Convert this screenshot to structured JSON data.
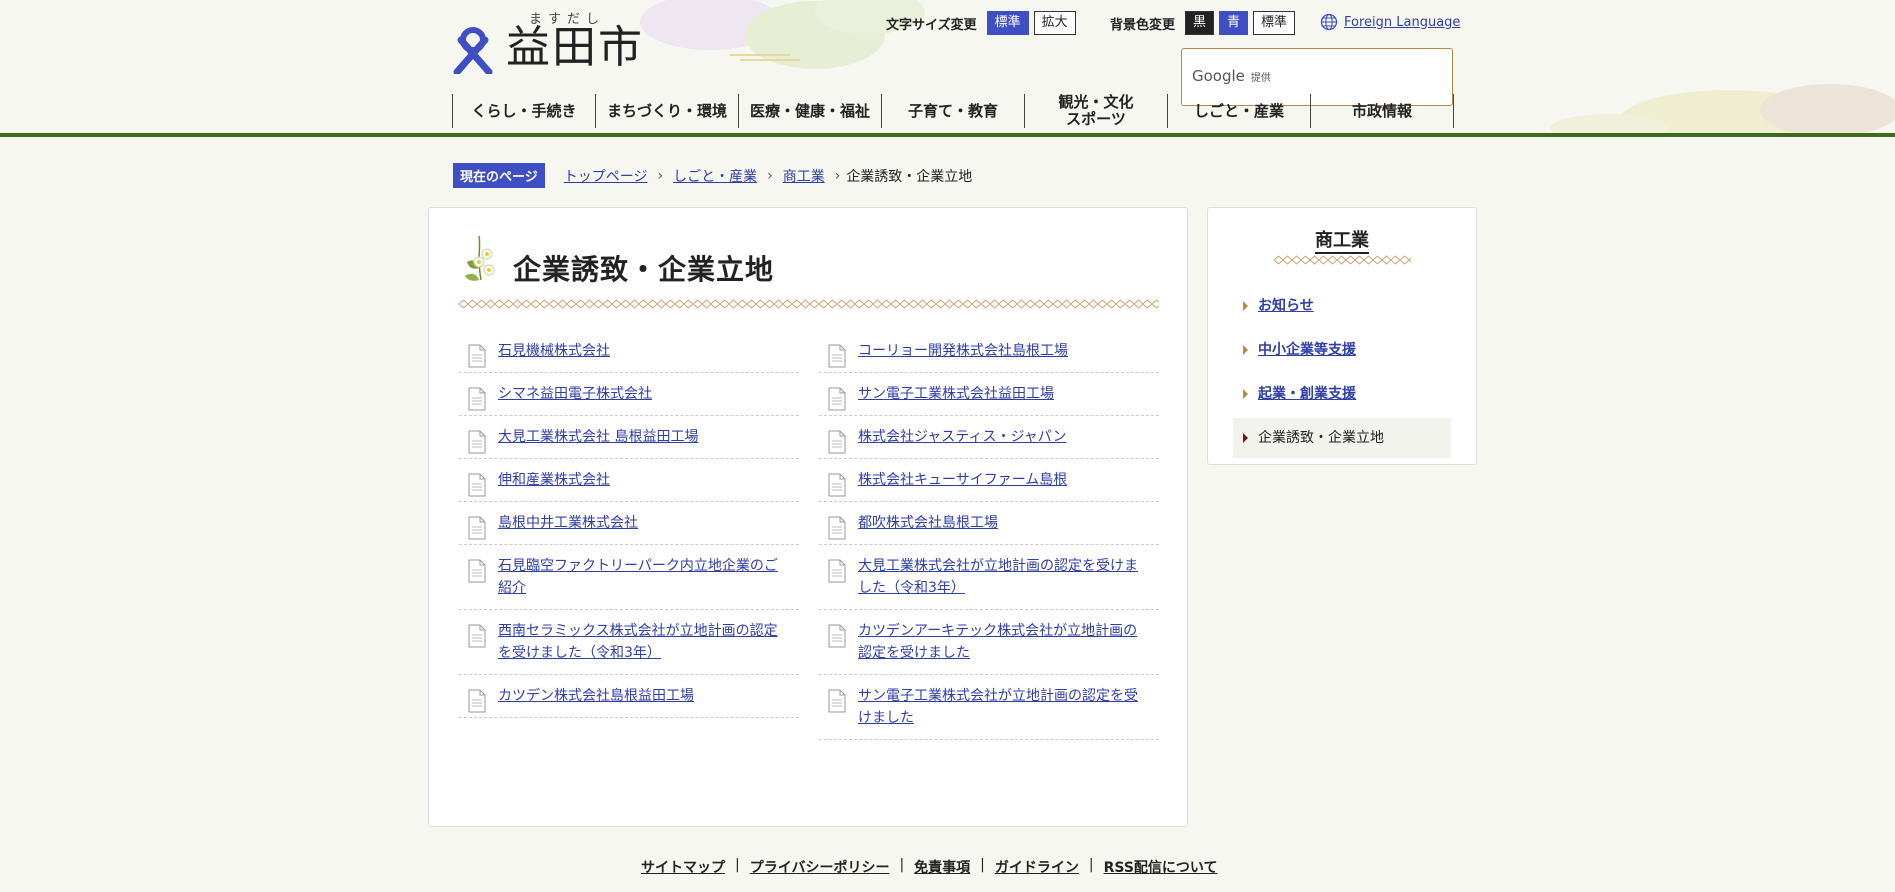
{
  "site": {
    "logo_text": "益田市",
    "logo_ruby": "ますだし"
  },
  "utility": {
    "font_size_label": "文字サイズ変更",
    "font_size_buttons": [
      "標準",
      "拡大"
    ],
    "bg_color_label": "背景色変更",
    "bg_color_buttons": [
      "黒",
      "青",
      "標準"
    ],
    "language_link": "Foreign Language"
  },
  "search": {
    "provider_text": "Google",
    "provided_label": "提供"
  },
  "global_nav": [
    "くらし・手続き",
    "まちづくり・環境",
    "医療・健康・福祉",
    "子育て・教育",
    "観光・文化\nスポーツ",
    "しごと・産業",
    "市政情報"
  ],
  "breadcrumb": {
    "current_label": "現在のページ",
    "links": [
      "トップページ",
      "しごと・産業",
      "商工業"
    ],
    "current": "企業誘致・企業立地"
  },
  "main": {
    "title": "企業誘致・企業立地",
    "left_links": [
      "石見機械株式会社",
      "シマネ益田電子株式会社",
      "大見工業株式会社 島根益田工場",
      "伸和産業株式会社",
      "島根中井工業株式会社",
      "石見臨空ファクトリーパーク内立地企業のご紹介",
      "西南セラミックス株式会社が立地計画の認定を受けました（令和3年）",
      "カツデン株式会社島根益田工場"
    ],
    "right_links": [
      "コーリョー開発株式会社島根工場",
      "サン電子工業株式会社益田工場",
      "株式会社ジャスティス・ジャパン",
      "株式会社キューサイファーム島根",
      "都吹株式会社島根工場",
      "大見工業株式会社が立地計画の認定を受けました（令和3年）",
      "カツデンアーキテック株式会社が立地計画の認定を受けました",
      "サン電子工業株式会社が立地計画の認定を受けました"
    ]
  },
  "sidebar": {
    "title": "商工業",
    "items": [
      "お知らせ",
      "中小企業等支援",
      "起業・創業支援",
      "企業誘致・企業立地"
    ]
  },
  "footer": {
    "links": [
      "サイトマップ",
      "プライバシーポリシー",
      "免責事項",
      "ガイドライン",
      "RSS配信について"
    ]
  },
  "colors": {
    "accent_blue": "#3f4fc3",
    "header_green": "#3f6a1e",
    "link_blue": "#2f3fa8",
    "gold": "#b9884a"
  }
}
